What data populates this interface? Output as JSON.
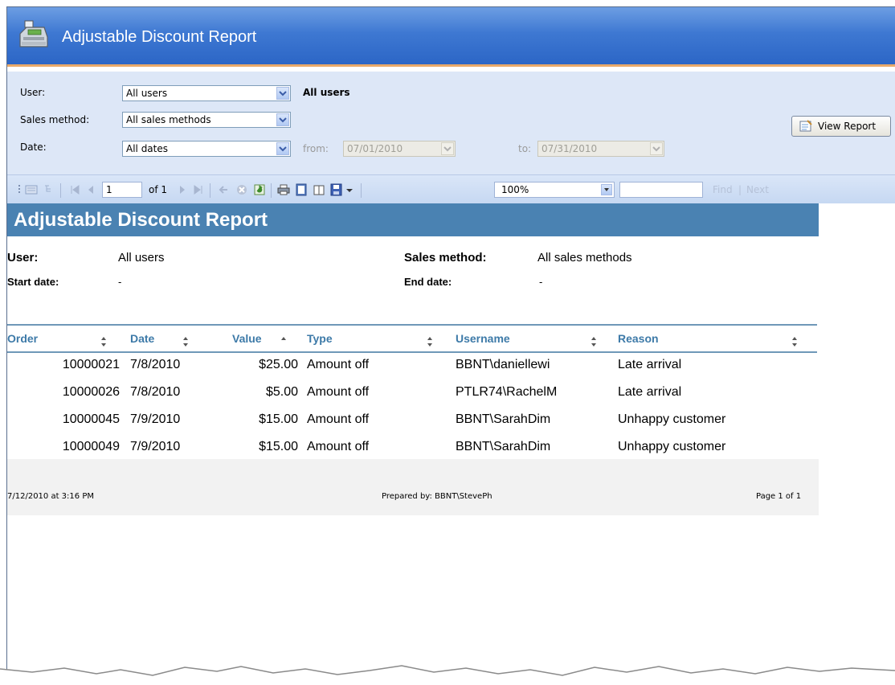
{
  "window": {
    "title": "Adjustable Discount Report"
  },
  "params": {
    "user_label": "User:",
    "user_value": "All users",
    "user_display": "All users",
    "sales_method_label": "Sales method:",
    "sales_method_value": "All sales methods",
    "date_label": "Date:",
    "date_value": "All dates",
    "from_label": "from:",
    "from_value": "07/01/2010",
    "to_label": "to:",
    "to_value": "07/31/2010",
    "view_report_label": "View Report"
  },
  "toolbar": {
    "page_value": "1",
    "of_pages": "of 1",
    "zoom": "100%",
    "find_label": "Find",
    "next_label": "Next",
    "find_sep": "|"
  },
  "report": {
    "title": "Adjustable Discount Report",
    "user_label": "User:",
    "user_value": "All users",
    "sales_method_label": "Sales method:",
    "sales_method_value": "All sales methods",
    "start_date_label": "Start date:",
    "start_date_value": "-",
    "end_date_label": "End date:",
    "end_date_value": "-",
    "columns": [
      "Order",
      "Date",
      "Value",
      "Type",
      "Username",
      "Reason"
    ],
    "rows": [
      [
        "10000021",
        "7/8/2010",
        "$25.00",
        "Amount off",
        "BBNT\\daniellewi",
        "Late arrival"
      ],
      [
        "10000026",
        "7/8/2010",
        "$5.00",
        "Amount off",
        "PTLR74\\RachelM",
        "Late arrival"
      ],
      [
        "10000045",
        "7/9/2010",
        "$15.00",
        "Amount off",
        "BBNT\\SarahDim",
        "Unhappy customer"
      ],
      [
        "10000049",
        "7/9/2010",
        "$15.00",
        "Amount off",
        "BBNT\\SarahDim",
        "Unhappy customer"
      ]
    ],
    "footer_timestamp": "7/12/2010 at 3:16 PM",
    "footer_prepared": "Prepared by: BBNT\\StevePh",
    "footer_page": "Page 1 of 1"
  },
  "colors": {
    "titlebar": "#3e78d2",
    "report_band": "#4a82b2",
    "header_text": "#3d7aa8",
    "params_bg": "#dde7f7"
  }
}
